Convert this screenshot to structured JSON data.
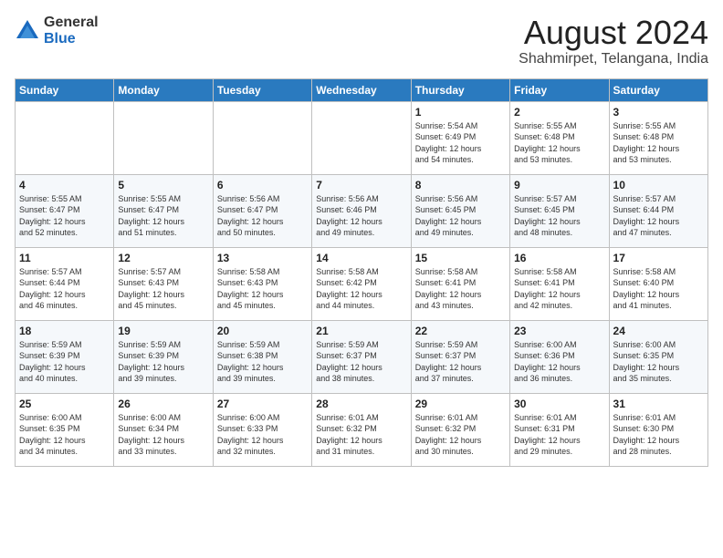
{
  "logo": {
    "general": "General",
    "blue": "Blue"
  },
  "title": {
    "month_year": "August 2024",
    "location": "Shahmirpet, Telangana, India"
  },
  "days_of_week": [
    "Sunday",
    "Monday",
    "Tuesday",
    "Wednesday",
    "Thursday",
    "Friday",
    "Saturday"
  ],
  "weeks": [
    [
      {
        "day": "",
        "info": ""
      },
      {
        "day": "",
        "info": ""
      },
      {
        "day": "",
        "info": ""
      },
      {
        "day": "",
        "info": ""
      },
      {
        "day": "1",
        "info": "Sunrise: 5:54 AM\nSunset: 6:49 PM\nDaylight: 12 hours\nand 54 minutes."
      },
      {
        "day": "2",
        "info": "Sunrise: 5:55 AM\nSunset: 6:48 PM\nDaylight: 12 hours\nand 53 minutes."
      },
      {
        "day": "3",
        "info": "Sunrise: 5:55 AM\nSunset: 6:48 PM\nDaylight: 12 hours\nand 53 minutes."
      }
    ],
    [
      {
        "day": "4",
        "info": "Sunrise: 5:55 AM\nSunset: 6:47 PM\nDaylight: 12 hours\nand 52 minutes."
      },
      {
        "day": "5",
        "info": "Sunrise: 5:55 AM\nSunset: 6:47 PM\nDaylight: 12 hours\nand 51 minutes."
      },
      {
        "day": "6",
        "info": "Sunrise: 5:56 AM\nSunset: 6:47 PM\nDaylight: 12 hours\nand 50 minutes."
      },
      {
        "day": "7",
        "info": "Sunrise: 5:56 AM\nSunset: 6:46 PM\nDaylight: 12 hours\nand 49 minutes."
      },
      {
        "day": "8",
        "info": "Sunrise: 5:56 AM\nSunset: 6:45 PM\nDaylight: 12 hours\nand 49 minutes."
      },
      {
        "day": "9",
        "info": "Sunrise: 5:57 AM\nSunset: 6:45 PM\nDaylight: 12 hours\nand 48 minutes."
      },
      {
        "day": "10",
        "info": "Sunrise: 5:57 AM\nSunset: 6:44 PM\nDaylight: 12 hours\nand 47 minutes."
      }
    ],
    [
      {
        "day": "11",
        "info": "Sunrise: 5:57 AM\nSunset: 6:44 PM\nDaylight: 12 hours\nand 46 minutes."
      },
      {
        "day": "12",
        "info": "Sunrise: 5:57 AM\nSunset: 6:43 PM\nDaylight: 12 hours\nand 45 minutes."
      },
      {
        "day": "13",
        "info": "Sunrise: 5:58 AM\nSunset: 6:43 PM\nDaylight: 12 hours\nand 45 minutes."
      },
      {
        "day": "14",
        "info": "Sunrise: 5:58 AM\nSunset: 6:42 PM\nDaylight: 12 hours\nand 44 minutes."
      },
      {
        "day": "15",
        "info": "Sunrise: 5:58 AM\nSunset: 6:41 PM\nDaylight: 12 hours\nand 43 minutes."
      },
      {
        "day": "16",
        "info": "Sunrise: 5:58 AM\nSunset: 6:41 PM\nDaylight: 12 hours\nand 42 minutes."
      },
      {
        "day": "17",
        "info": "Sunrise: 5:58 AM\nSunset: 6:40 PM\nDaylight: 12 hours\nand 41 minutes."
      }
    ],
    [
      {
        "day": "18",
        "info": "Sunrise: 5:59 AM\nSunset: 6:39 PM\nDaylight: 12 hours\nand 40 minutes."
      },
      {
        "day": "19",
        "info": "Sunrise: 5:59 AM\nSunset: 6:39 PM\nDaylight: 12 hours\nand 39 minutes."
      },
      {
        "day": "20",
        "info": "Sunrise: 5:59 AM\nSunset: 6:38 PM\nDaylight: 12 hours\nand 39 minutes."
      },
      {
        "day": "21",
        "info": "Sunrise: 5:59 AM\nSunset: 6:37 PM\nDaylight: 12 hours\nand 38 minutes."
      },
      {
        "day": "22",
        "info": "Sunrise: 5:59 AM\nSunset: 6:37 PM\nDaylight: 12 hours\nand 37 minutes."
      },
      {
        "day": "23",
        "info": "Sunrise: 6:00 AM\nSunset: 6:36 PM\nDaylight: 12 hours\nand 36 minutes."
      },
      {
        "day": "24",
        "info": "Sunrise: 6:00 AM\nSunset: 6:35 PM\nDaylight: 12 hours\nand 35 minutes."
      }
    ],
    [
      {
        "day": "25",
        "info": "Sunrise: 6:00 AM\nSunset: 6:35 PM\nDaylight: 12 hours\nand 34 minutes."
      },
      {
        "day": "26",
        "info": "Sunrise: 6:00 AM\nSunset: 6:34 PM\nDaylight: 12 hours\nand 33 minutes."
      },
      {
        "day": "27",
        "info": "Sunrise: 6:00 AM\nSunset: 6:33 PM\nDaylight: 12 hours\nand 32 minutes."
      },
      {
        "day": "28",
        "info": "Sunrise: 6:01 AM\nSunset: 6:32 PM\nDaylight: 12 hours\nand 31 minutes."
      },
      {
        "day": "29",
        "info": "Sunrise: 6:01 AM\nSunset: 6:32 PM\nDaylight: 12 hours\nand 30 minutes."
      },
      {
        "day": "30",
        "info": "Sunrise: 6:01 AM\nSunset: 6:31 PM\nDaylight: 12 hours\nand 29 minutes."
      },
      {
        "day": "31",
        "info": "Sunrise: 6:01 AM\nSunset: 6:30 PM\nDaylight: 12 hours\nand 28 minutes."
      }
    ]
  ]
}
